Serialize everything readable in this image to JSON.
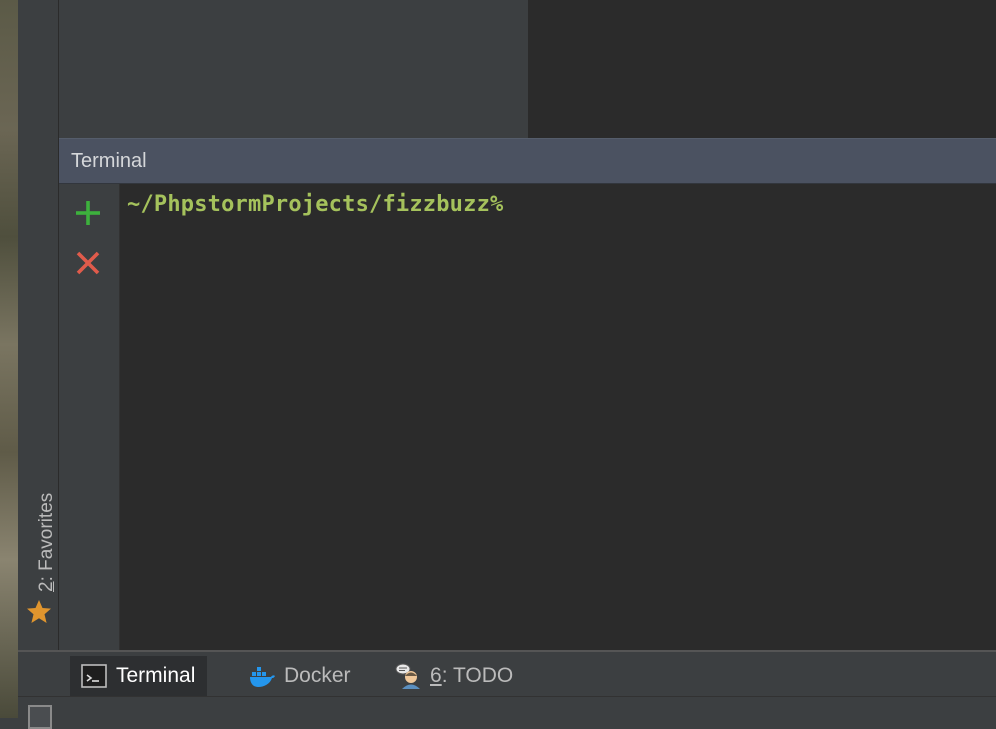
{
  "favorites": {
    "number": "2",
    "rest": ": Favorites",
    "icon": "star-icon"
  },
  "terminal": {
    "title": "Terminal",
    "prompt": "~/PhpstormProjects/fizzbuzz%",
    "toolbar": [
      {
        "name": "new-session-button",
        "icon": "plus-icon",
        "color": "#3db13d"
      },
      {
        "name": "close-session-button",
        "icon": "close-icon",
        "color": "#e05b4b"
      }
    ]
  },
  "bottom_tabs": {
    "terminal": {
      "label": "Terminal",
      "icon": "terminal-icon",
      "active": true
    },
    "docker": {
      "label": "Docker",
      "icon": "docker-icon"
    },
    "todo": {
      "number": "6",
      "rest": ": TODO",
      "icon": "todo-icon"
    }
  },
  "colors": {
    "prompt": "#a5c25c",
    "header": "#4b5261",
    "background": "#2b2b2b",
    "panel": "#3c3f41"
  }
}
